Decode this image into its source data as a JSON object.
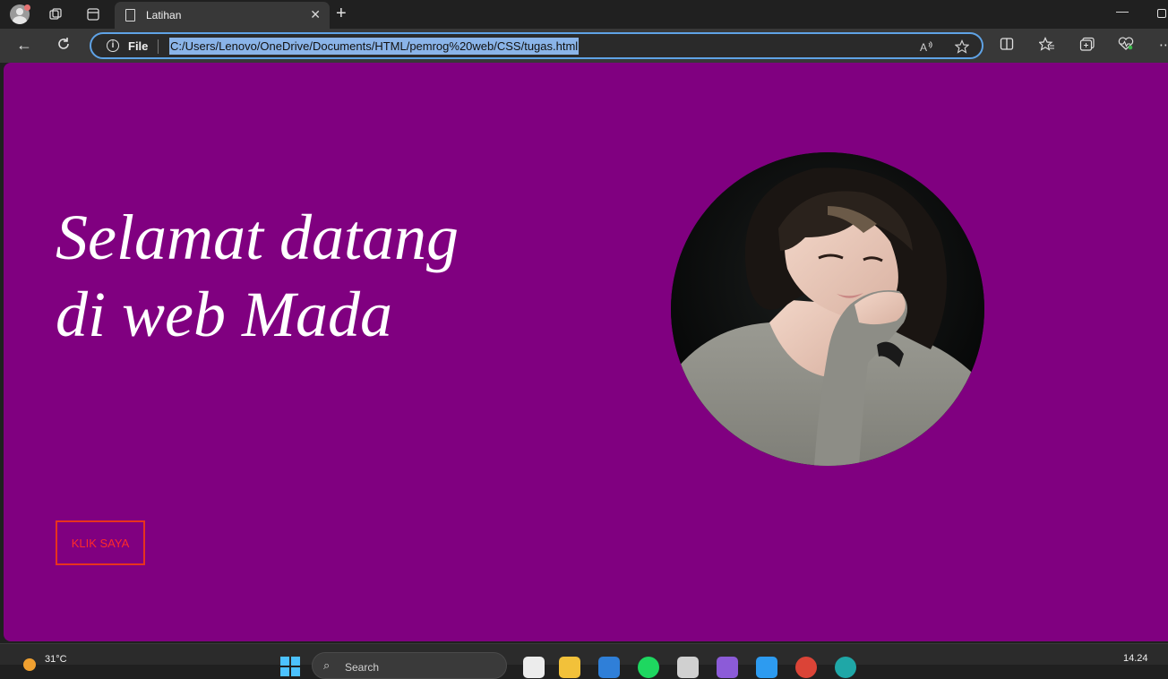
{
  "browser": {
    "tab_title": "Latihan",
    "new_tab_symbol": "+",
    "address_scheme_label": "File",
    "url": "C:/Users/Lenovo/OneDrive/Documents/HTML/pemrog%20web/CSS/tugas.html",
    "accent_color": "#5fa3e6"
  },
  "page": {
    "background_color": "#800080",
    "headline_line1": "Selamat datang",
    "headline_line2": "di web Mada",
    "button_label": "KLIK SAYA",
    "button_color": "#ff2a2a",
    "profile_image": "portrait-photo"
  },
  "taskbar": {
    "temperature": "31°C",
    "search_placeholder": "Search",
    "time": "14.24"
  }
}
